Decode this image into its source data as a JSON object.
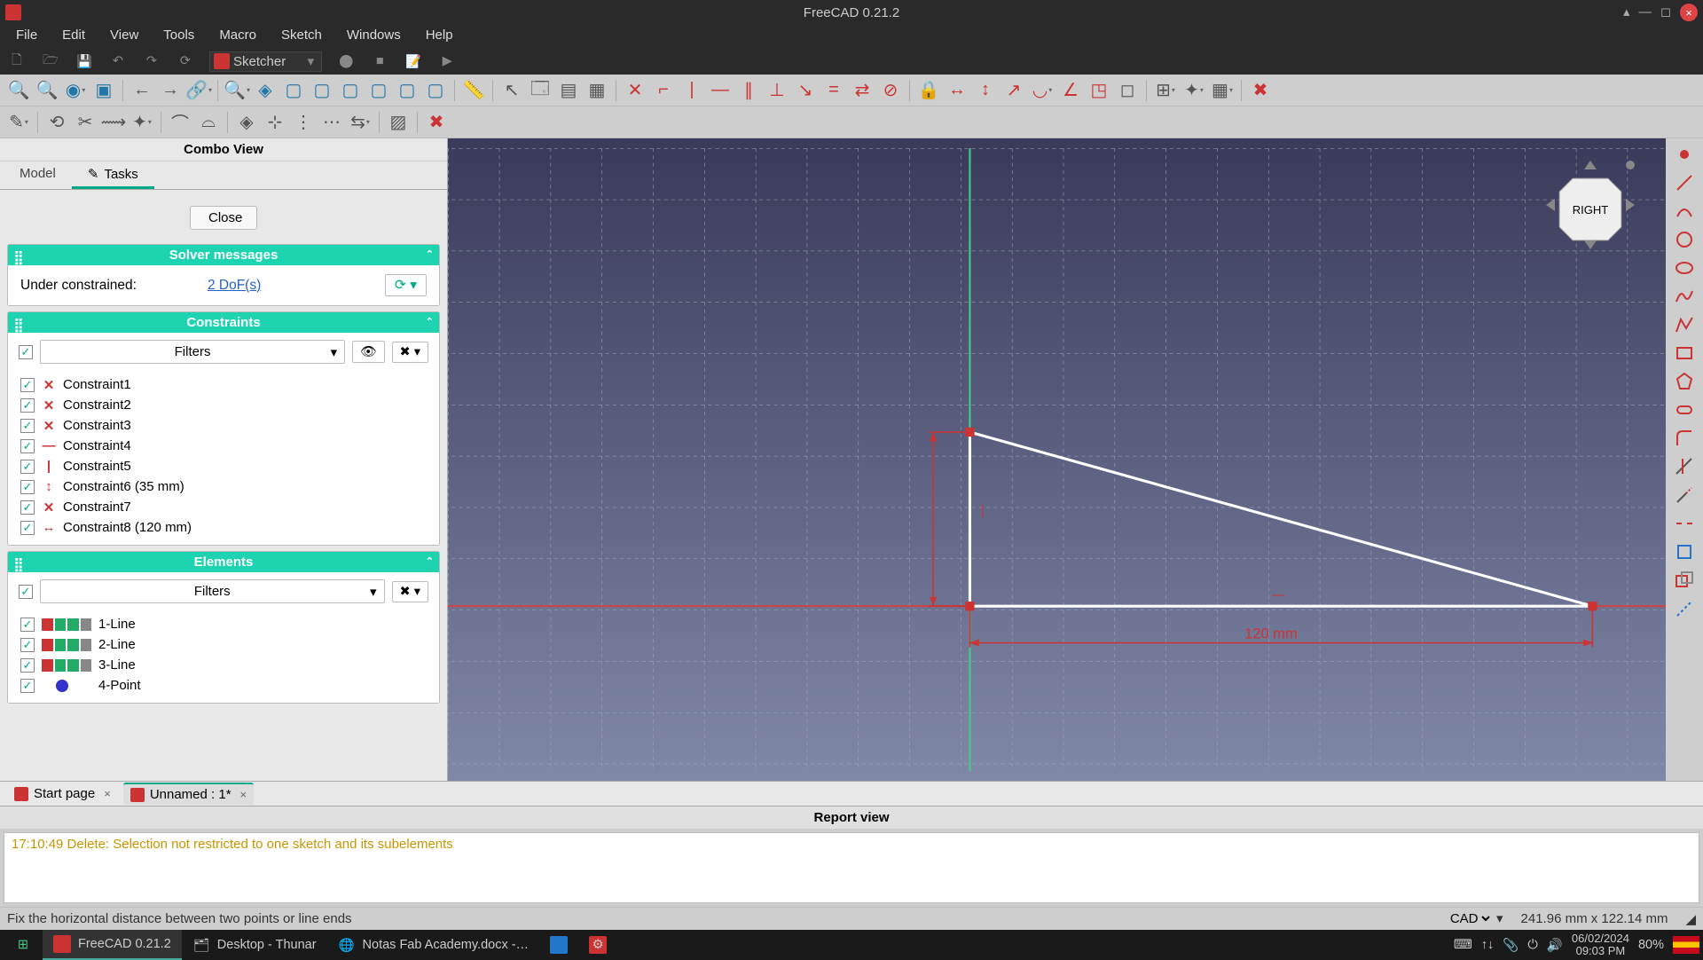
{
  "app": {
    "title": "FreeCAD 0.21.2"
  },
  "menu": [
    "File",
    "Edit",
    "View",
    "Tools",
    "Macro",
    "Sketch",
    "Windows",
    "Help"
  ],
  "workbench": "Sketcher",
  "combo": {
    "title": "Combo View",
    "tabs": [
      "Model",
      "Tasks"
    ],
    "active_tab": 1,
    "close": "Close",
    "solver": {
      "title": "Solver messages",
      "status": "Under constrained:",
      "dof": "2 DoF(s)"
    },
    "constraints": {
      "title": "Constraints",
      "filter": "Filters",
      "items": [
        {
          "label": "Constraint1",
          "icon": "coincident"
        },
        {
          "label": "Constraint2",
          "icon": "coincident"
        },
        {
          "label": "Constraint3",
          "icon": "coincident"
        },
        {
          "label": "Constraint4",
          "icon": "horizontal"
        },
        {
          "label": "Constraint5",
          "icon": "vertical"
        },
        {
          "label": "Constraint6 (35 mm)",
          "icon": "distance-v"
        },
        {
          "label": "Constraint7",
          "icon": "coincident"
        },
        {
          "label": "Constraint8 (120 mm)",
          "icon": "distance-h"
        }
      ]
    },
    "elements": {
      "title": "Elements",
      "filter": "Filters",
      "items": [
        {
          "label": "1-Line",
          "kind": "line"
        },
        {
          "label": "2-Line",
          "kind": "line"
        },
        {
          "label": "3-Line",
          "kind": "line"
        },
        {
          "label": "4-Point",
          "kind": "point"
        }
      ]
    }
  },
  "viewport": {
    "cube_face": "RIGHT",
    "dim_h": "120 mm",
    "dim_v_approx": "35"
  },
  "doctabs": [
    {
      "label": "Start page",
      "active": false
    },
    {
      "label": "Unnamed : 1*",
      "active": true
    }
  ],
  "report": {
    "title": "Report view",
    "lines": [
      "17:10:49  Delete: Selection not restricted to one sketch and its subelements"
    ]
  },
  "status": {
    "left": "Fix the horizontal distance between two points or line ends",
    "nav": "CAD",
    "coord": "241.96 mm x 122.14 mm"
  },
  "taskbar": {
    "items": [
      {
        "label": "FreeCAD 0.21.2",
        "active": true
      },
      {
        "label": "Desktop - Thunar",
        "active": false
      },
      {
        "label": "Notas Fab Academy.docx -…",
        "active": false
      }
    ],
    "date": "06/02/2024",
    "time": "09:03 PM",
    "battery": "80%"
  }
}
